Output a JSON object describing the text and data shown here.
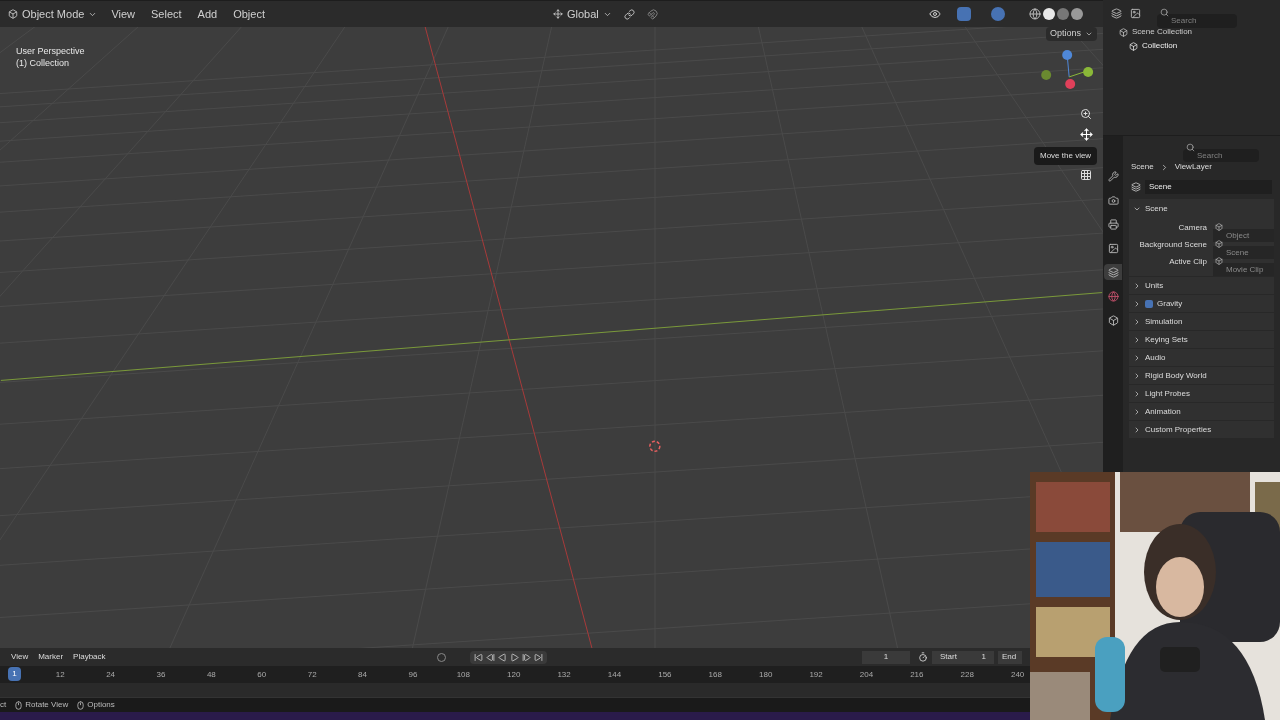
{
  "header": {
    "mode": "Object Mode",
    "menus": [
      "View",
      "Select",
      "Add",
      "Object"
    ],
    "orientation": "Global"
  },
  "viewport": {
    "view_name": "User Perspective",
    "collection": "(1) Collection",
    "options": "Options",
    "tooltip": "Move the view"
  },
  "outliner": {
    "search_placeholder": "Search",
    "items": [
      {
        "label": "Scene Collection",
        "children": [
          {
            "label": "Collection"
          }
        ]
      }
    ]
  },
  "properties": {
    "search_placeholder": "Search",
    "breadcrumb": [
      "Scene",
      "ViewLayer"
    ],
    "datablock": "Scene",
    "tabs": [
      {
        "kind": "tool",
        "selected": false
      },
      {
        "kind": "render",
        "selected": false
      },
      {
        "kind": "output",
        "selected": false
      },
      {
        "kind": "view_layer",
        "selected": false
      },
      {
        "kind": "scene",
        "selected": true
      },
      {
        "kind": "world",
        "selected": false
      },
      {
        "kind": "collection",
        "selected": false
      }
    ],
    "panel": {
      "title": "Scene",
      "expanded": true,
      "fields": [
        {
          "label": "Camera",
          "placeholder": "Object"
        },
        {
          "label": "Background Scene",
          "placeholder": "Scene"
        },
        {
          "label": "Active Clip",
          "placeholder": "Movie Clip"
        }
      ]
    },
    "sections": [
      {
        "title": "Units",
        "kind": "plain",
        "expanded": false
      },
      {
        "title": "Gravity",
        "kind": "checkbox",
        "checked": true,
        "expanded": false
      },
      {
        "title": "Simulation",
        "kind": "plain",
        "expanded": false
      },
      {
        "title": "Keying Sets",
        "kind": "plain",
        "expanded": false
      },
      {
        "title": "Audio",
        "kind": "plain",
        "expanded": false
      },
      {
        "title": "Rigid Body World",
        "kind": "plain",
        "expanded": false
      },
      {
        "title": "Light Probes",
        "kind": "plain",
        "expanded": false
      },
      {
        "title": "Animation",
        "kind": "plain",
        "expanded": false
      },
      {
        "title": "Custom Properties",
        "kind": "plain",
        "expanded": false
      }
    ]
  },
  "timeline": {
    "menus": [
      "View",
      "Marker",
      "Playback"
    ],
    "current_frame": "1",
    "start_label": "Start",
    "start": "1",
    "end_label": "End",
    "playhead": "1",
    "ticks": [
      "12",
      "24",
      "36",
      "48",
      "60",
      "72",
      "84",
      "96",
      "108",
      "120",
      "132",
      "144",
      "156",
      "168",
      "180",
      "192",
      "204",
      "216",
      "228",
      "240"
    ]
  },
  "status_bar": [
    "ct",
    "Rotate View",
    "Options"
  ],
  "webcam": {
    "kind": "picture"
  }
}
